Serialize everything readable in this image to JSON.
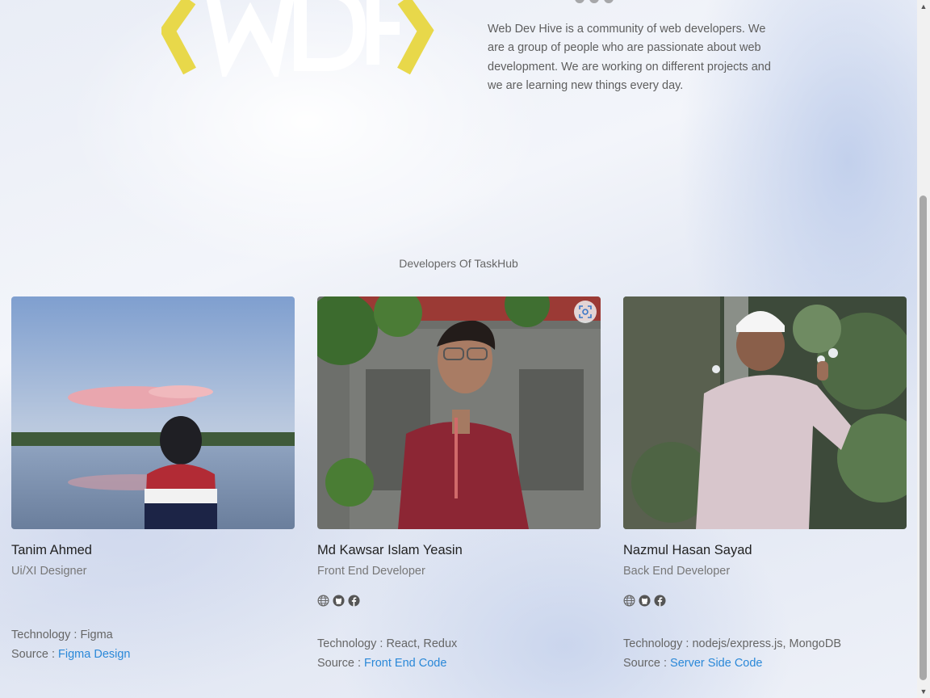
{
  "about": {
    "text": "Web Dev Hive is a community of web developers. We are a group of people who are passionate about web development. We are working on different projects and we are learning new things every day."
  },
  "section": {
    "title": "Developers Of TaskHub"
  },
  "developers": [
    {
      "name": "Tanim Ahmed",
      "role": "Ui/XI Designer",
      "tech_prefix": "Technology : ",
      "tech": "Figma",
      "source_prefix": "Source : ",
      "source_link": "Figma Design"
    },
    {
      "name": "Md Kawsar Islam Yeasin",
      "role": "Front End Developer",
      "tech_prefix": "Technology : ",
      "tech": "React, Redux",
      "source_prefix": "Source : ",
      "source_link": "Front End Code"
    },
    {
      "name": "Nazmul Hasan Sayad",
      "role": "Back End Developer",
      "tech_prefix": "Technology : ",
      "tech": "nodejs/express.js, MongoDB",
      "source_prefix": "Source : ",
      "source_link": "Server Side Code"
    }
  ],
  "icons": [
    "globe-icon",
    "github-icon",
    "facebook-icon"
  ],
  "colors": {
    "link": "#2a88d8",
    "logo_bracket": "#e8d84a"
  }
}
